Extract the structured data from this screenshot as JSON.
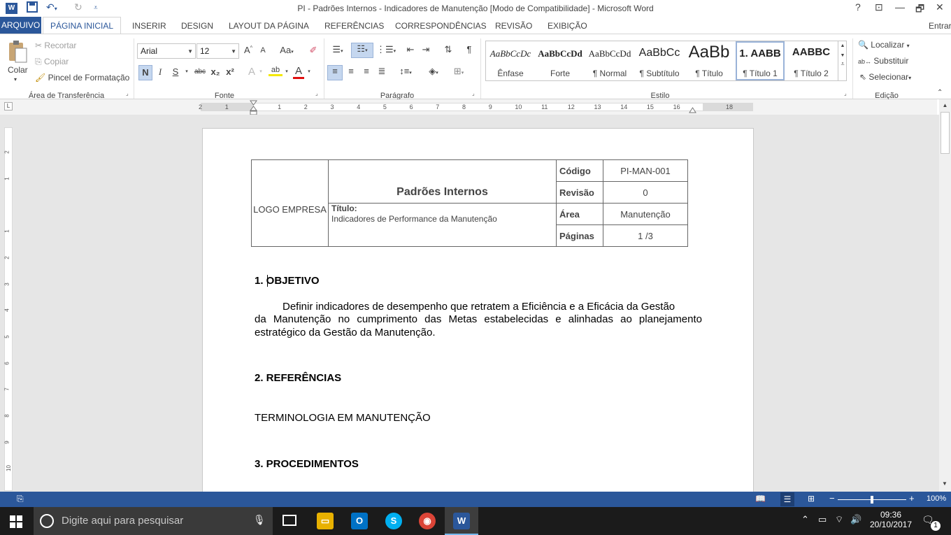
{
  "window": {
    "title": "PI - Padrões Internos - Indicadores de Manutenção [Modo de Compatibilidade] - Microsoft Word",
    "controls": {
      "help": "?",
      "ribbon_opts": "⊡",
      "minimize": "—",
      "restore": "🗗",
      "close": "✕"
    }
  },
  "quick_access": {
    "word_logo": "W",
    "save_icon": "save-icon",
    "undo_icon": "undo-icon",
    "redo_icon": "redo-icon"
  },
  "tabs": {
    "arquivo": "ARQUIVO",
    "items": [
      "PÁGINA INICIAL",
      "INSERIR",
      "DESIGN",
      "LAYOUT DA PÁGINA",
      "REFERÊNCIAS",
      "CORRESPONDÊNCIAS",
      "REVISÃO",
      "EXIBIÇÃO"
    ],
    "signin": "Entrar"
  },
  "ribbon": {
    "clipboard": {
      "group": "Área de Transferência",
      "paste": "Colar",
      "cut": "Recortar",
      "copy": "Copiar",
      "format_painter": "Pincel de Formatação"
    },
    "font": {
      "group": "Fonte",
      "font_name": "Arial",
      "font_size": "12",
      "grow": "A",
      "shrink": "A",
      "case": "Aa",
      "bold": "N",
      "italic": "I",
      "underline": "S",
      "strike": "abc",
      "subscript": "x₂",
      "superscript": "x²",
      "text_effects": "A",
      "highlight": "ab",
      "font_color": "A"
    },
    "paragraph": {
      "group": "Parágrafo",
      "pilcrow": "¶"
    },
    "styles": {
      "group": "Estilo",
      "items": [
        {
          "preview": "AaBbCcDc",
          "name": "Ênfase"
        },
        {
          "preview": "AaBbCcDd",
          "name": "Forte"
        },
        {
          "preview": "AaBbCcDd",
          "name": "¶ Normal"
        },
        {
          "preview": "AaBbCc",
          "name": "¶ Subtítulo"
        },
        {
          "preview": "AaBb",
          "name": "¶ Título"
        },
        {
          "preview": "1. AABB",
          "name": "¶ Título 1"
        },
        {
          "preview": "AABBC",
          "name": "¶ Título 2"
        }
      ]
    },
    "editing": {
      "group": "Edição",
      "find": "Localizar",
      "replace": "Substituir",
      "select": "Selecionar"
    }
  },
  "ruler": {
    "marks": [
      "2",
      "1",
      "",
      "1",
      "2",
      "3",
      "4",
      "5",
      "6",
      "7",
      "8",
      "9",
      "10",
      "11",
      "12",
      "13",
      "14",
      "15",
      "16",
      "",
      "18"
    ],
    "vmarks": [
      "2",
      "1",
      "",
      "1",
      "2",
      "3",
      "4",
      "5",
      "6",
      "7",
      "8",
      "9",
      "10"
    ]
  },
  "document": {
    "header": {
      "logo": "LOGO EMPRESA",
      "title": "Padrões Internos",
      "subtitle_label": "Título:",
      "subtitle_value": "Indicadores de Performance da Manutenção",
      "rows": [
        {
          "label": "Código",
          "value": "PI-MAN-001"
        },
        {
          "label": "Revisão",
          "value": "0"
        },
        {
          "label": "Área",
          "value": "Manutenção"
        },
        {
          "label": "Páginas",
          "value": "1 /3"
        }
      ]
    },
    "section1_title": "1. OBJETIVO",
    "section1_line1": "Definir indicadores de desempenho que retratem a Eficiência e a Eficácia da Gestão",
    "section1_line2": "da Manutenção no cumprimento das Metas estabelecidas e alinhadas ao planejamento",
    "section1_line3": "estratégico da Gestão da Manutenção.",
    "section2_title": "2. REFERÊNCIAS",
    "section2_body": "TERMINOLOGIA EM MANUTENÇÃO",
    "section3_title": "3. PROCEDIMENTOS"
  },
  "statusbar": {
    "zoom": "100%",
    "minus": "−",
    "plus": "+"
  },
  "taskbar": {
    "search_placeholder": "Digite aqui para pesquisar",
    "time": "09:36",
    "date": "20/10/2017",
    "notifications": "1"
  },
  "colors": {
    "word_blue": "#2b579a",
    "taskbar": "#1b1b1b"
  }
}
